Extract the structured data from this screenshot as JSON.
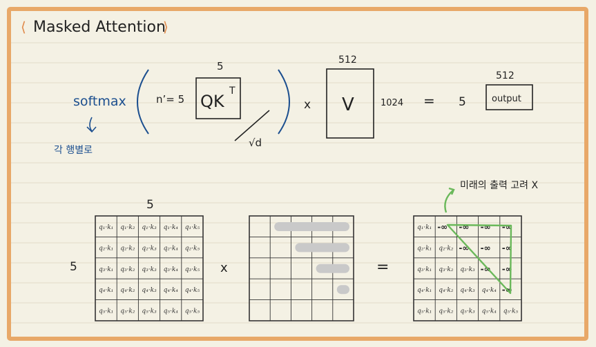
{
  "title": "Masked Attention",
  "formula": {
    "func": "softmax",
    "note": "각 행별로",
    "n_label": "n’= 5",
    "qk_dim": "5",
    "qk": "QK",
    "qk_sup": "T",
    "sqrt_d": "√d",
    "times": "x",
    "v_dim": "512",
    "v": "V",
    "v_rows": "1024",
    "equals": "=",
    "out_rows": "5",
    "out_dim": "512",
    "output": "output"
  },
  "bottom": {
    "qk_cols": "5",
    "qk_rows": "5",
    "times": "x",
    "equals": "=",
    "note": "미래의 출력 고려 X",
    "qk_matrix": [
      [
        "q₁·k₁",
        "q₁·k₂",
        "q₁·k₃",
        "q₁·k₄",
        "q₁·k₅"
      ],
      [
        "q₂·k₁",
        "q₂·k₂",
        "q₂·k₃",
        "q₂·k₄",
        "q₂·k₅"
      ],
      [
        "q₃·k₁",
        "q₃·k₂",
        "q₃·k₃",
        "q₃·k₄",
        "q₃·k₅"
      ],
      [
        "q₄·k₁",
        "q₄·k₂",
        "q₄·k₃",
        "q₄·k₄",
        "q₄·k₅"
      ],
      [
        "q₅·k₁",
        "q₅·k₂",
        "q₅·k₃",
        "q₅·k₄",
        "q₅·k₅"
      ]
    ],
    "masked_matrix": [
      [
        "q₁·k₁",
        "-∞",
        "-∞",
        "-∞",
        "-∞"
      ],
      [
        "q₂·k₁",
        "q₂·k₂",
        "-∞",
        "-∞",
        "-∞"
      ],
      [
        "q₃·k₁",
        "q₃·k₂",
        "q₃·k₃",
        "-∞",
        "-∞"
      ],
      [
        "q₄·k₁",
        "q₄·k₂",
        "q₄·k₃",
        "q₄·k₄",
        "-∞"
      ],
      [
        "q₅·k₁",
        "q₅·k₂",
        "q₅·k₃",
        "q₅·k₄",
        "q₅·k₅"
      ]
    ]
  },
  "colors": {
    "frame": "#e8a868",
    "ink": "#222222",
    "blue": "#1c4f8f",
    "green": "#6ab85a",
    "mask_bar": "#c9c9c9"
  }
}
